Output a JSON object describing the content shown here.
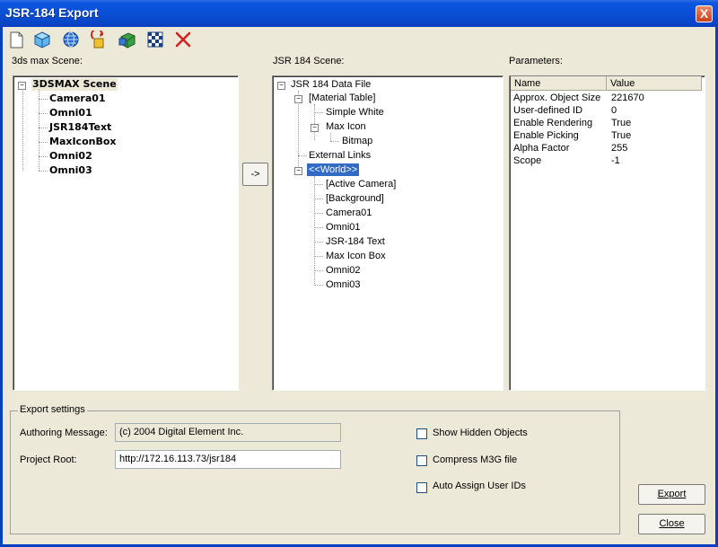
{
  "window": {
    "title": "JSR-184 Export",
    "close_label": "X"
  },
  "toolbar": {
    "icons": [
      "new-file-icon",
      "cube-icon",
      "globe-icon",
      "import-icon",
      "mesh-icon",
      "checker-icon",
      "delete-icon"
    ]
  },
  "left_panel": {
    "label": "3ds max Scene:",
    "root": "3DSMAX Scene",
    "items": [
      "Camera01",
      "Omni01",
      "JSR184Text",
      "MaxIconBox",
      "Omni02",
      "Omni03"
    ]
  },
  "transfer_button": {
    "label": "->"
  },
  "middle_panel": {
    "label": "JSR 184 Scene:",
    "root": "JSR 184 Data File",
    "material_table": "[Material Table]",
    "simple_white": "Simple White",
    "max_icon": "Max Icon",
    "bitmap": "Bitmap",
    "external_links": "External Links",
    "world": "<<World>>",
    "world_items": [
      "[Active Camera]",
      "[Background]",
      "Camera01",
      "Omni01",
      "JSR-184 Text",
      "Max Icon Box",
      "Omni02",
      "Omni03"
    ]
  },
  "params_panel": {
    "label": "Parameters:",
    "col_name": "Name",
    "col_value": "Value",
    "rows": [
      {
        "name": "Approx. Object Size",
        "value": "221670"
      },
      {
        "name": "User-defined ID",
        "value": "0"
      },
      {
        "name": "Enable Rendering",
        "value": "True"
      },
      {
        "name": "Enable Picking",
        "value": "True"
      },
      {
        "name": "Alpha Factor",
        "value": "255"
      },
      {
        "name": "Scope",
        "value": "-1"
      }
    ]
  },
  "export_settings": {
    "title": "Export settings",
    "authoring_label": "Authoring Message:",
    "authoring_value": "(c) 2004 Digital Element Inc.",
    "project_label": "Project Root:",
    "project_value": "http://172.16.113.73/jsr184",
    "show_hidden": "Show Hidden Objects",
    "compress": "Compress M3G file",
    "auto_assign": "Auto Assign User IDs"
  },
  "buttons": {
    "export": "Export",
    "close": "Close"
  }
}
